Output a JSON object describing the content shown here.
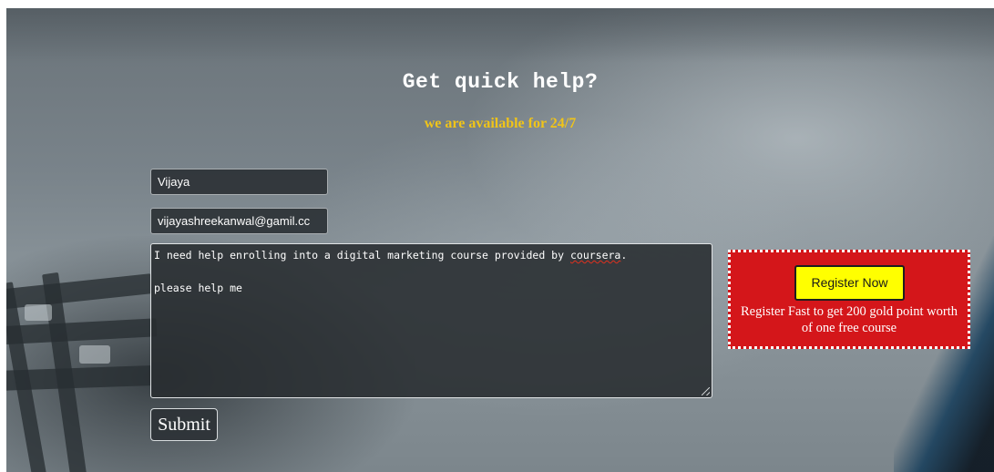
{
  "header": {
    "title": "Get quick help?",
    "subtitle": "we are available for 24/7"
  },
  "form": {
    "name_value": "Vijaya",
    "email_value": "vijayashreekanwal@gamil.cc",
    "message_line1_before": "I need help enrolling into a digital marketing course provided by ",
    "message_line1_misspelled": "coursera",
    "message_line1_after": ".",
    "message_line2": "please help me",
    "submit_label": "Submit"
  },
  "promo": {
    "button_label": "Register Now",
    "text": "Register Fast to get 200 gold point worth of one free course"
  },
  "colors": {
    "title_text": "#ffffff",
    "subtitle_text": "#f0c419",
    "promo_background": "#d4161a",
    "register_button_background": "#ffff00"
  }
}
